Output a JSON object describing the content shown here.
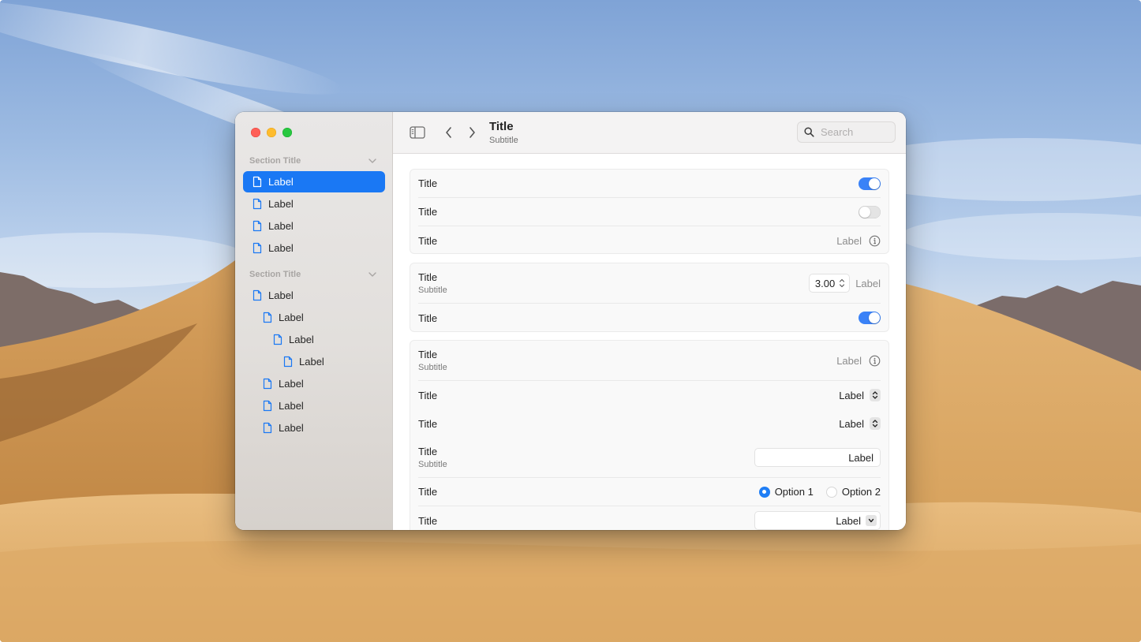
{
  "colors": {
    "accent": "#1a78f4",
    "toggle_on": "#3a82f7",
    "traffic_close": "#fe5f57",
    "traffic_minimize": "#febc2e",
    "traffic_zoom": "#28c840"
  },
  "sidebar": {
    "sections": [
      {
        "title": "Section Title",
        "items": [
          {
            "label": "Label",
            "icon": "doc-icon",
            "selected": true
          },
          {
            "label": "Label",
            "icon": "doc-icon"
          },
          {
            "label": "Label",
            "icon": "doc-icon"
          },
          {
            "label": "Label",
            "icon": "doc-icon"
          }
        ]
      },
      {
        "title": "Section Title",
        "items": [
          {
            "label": "Label",
            "icon": "doc-icon"
          },
          {
            "label": "Label",
            "icon": "doc-icon"
          },
          {
            "label": "Label",
            "icon": "doc-icon"
          },
          {
            "label": "Label",
            "icon": "doc-icon"
          },
          {
            "label": "Label",
            "icon": "doc-icon"
          },
          {
            "label": "Label",
            "icon": "doc-icon"
          },
          {
            "label": "Label",
            "icon": "doc-icon"
          }
        ]
      }
    ]
  },
  "toolbar": {
    "title": "Title",
    "subtitle": "Subtitle",
    "search_placeholder": "Search"
  },
  "groups": [
    {
      "rows": [
        {
          "title": "Title",
          "control": "toggle",
          "on": true
        },
        {
          "title": "Title",
          "control": "toggle",
          "on": false
        },
        {
          "title": "Title",
          "control": "label-info",
          "label": "Label"
        }
      ]
    },
    {
      "rows": [
        {
          "title": "Title",
          "subtitle": "Subtitle",
          "control": "stepper",
          "value": "3.00",
          "label": "Label"
        },
        {
          "title": "Title",
          "control": "toggle",
          "on": true
        }
      ]
    },
    {
      "rows": [
        {
          "title": "Title",
          "subtitle": "Subtitle",
          "control": "label-info",
          "label": "Label"
        },
        {
          "title": "Title",
          "control": "popup",
          "label": "Label"
        },
        {
          "title": "Title",
          "control": "popup",
          "label": "Label"
        },
        {
          "title": "Title",
          "subtitle": "Subtitle",
          "control": "text-field",
          "value": "Label"
        },
        {
          "title": "Title",
          "control": "radio",
          "options": [
            "Option 1",
            "Option 2"
          ],
          "selected": "Option 1"
        },
        {
          "title": "Title",
          "control": "combo",
          "value": "Label"
        }
      ]
    }
  ]
}
